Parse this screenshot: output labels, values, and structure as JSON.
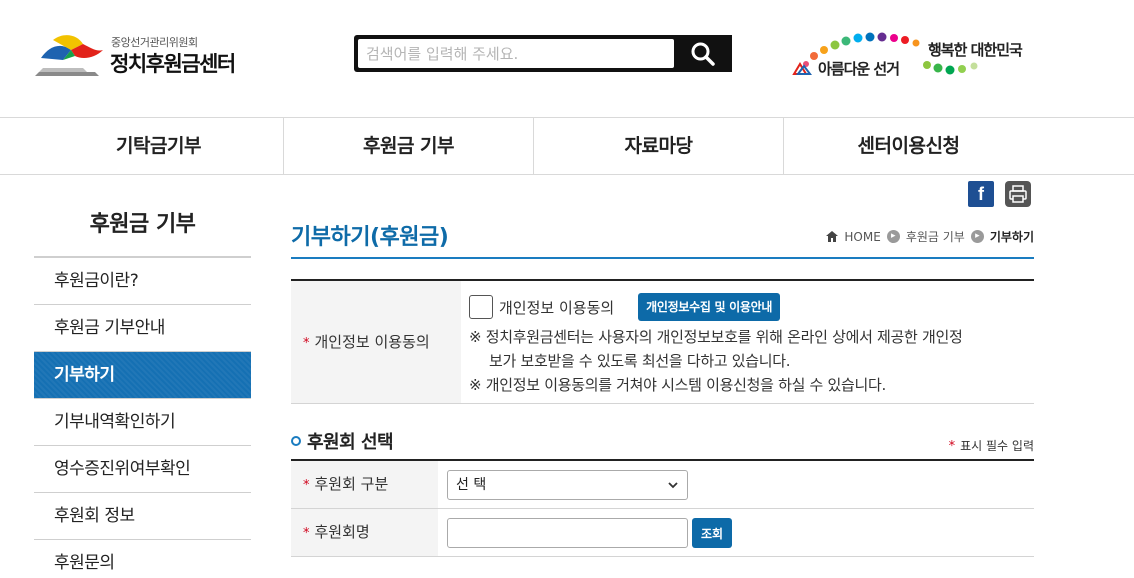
{
  "header": {
    "logo_sub": "중앙선거관리위원회",
    "logo_main": "정치후원금센터",
    "search": {
      "placeholder": "검색어를 입력해 주세요."
    },
    "slogan_right": "행복한 대한민국",
    "slogan_left": "아름다운 선거"
  },
  "nav": {
    "items": [
      {
        "label": "기탁금기부"
      },
      {
        "label": "후원금 기부"
      },
      {
        "label": "자료마당"
      },
      {
        "label": "센터이용신청"
      }
    ]
  },
  "social": {
    "facebook_glyph": "f"
  },
  "sidebar": {
    "title": "후원금 기부",
    "items": [
      {
        "label": "후원금이란?",
        "active": false
      },
      {
        "label": "후원금 기부안내",
        "active": false
      },
      {
        "label": "기부하기",
        "active": true
      },
      {
        "label": "기부내역확인하기",
        "active": false
      },
      {
        "label": "영수증진위여부확인",
        "active": false
      },
      {
        "label": "후원회 정보",
        "active": false
      },
      {
        "label": "후원문의",
        "active": false
      }
    ]
  },
  "content": {
    "page_title": "기부하기(후원금)",
    "breadcrumb": {
      "home": "HOME",
      "level1": "후원금 기부",
      "current": "기부하기"
    },
    "consent": {
      "label": "개인정보 이용동의",
      "checkbox_label": "개인정보 이용동의",
      "button_label": "개인정보수집 및 이용안내",
      "notice_1a": "※ 정치후원금센터는 사용자의 개인정보보호를 위해 온라인 상에서 제공한 개인정",
      "notice_1b": "보가 보호받을 수 있도록 최선을 다하고 있습니다.",
      "notice_2": "※ 개인정보 이용동의를 거쳐야 시스템 이용신청을 하실 수 있습니다."
    },
    "section": {
      "title": "후원회 선택",
      "required_note": "표시 필수 입력"
    },
    "form": {
      "type_label": "후원회 구분",
      "type_value": "선 택",
      "name_label": "후원회명",
      "name_value": "",
      "search_button": "조회"
    },
    "required_mark": "*"
  },
  "colors": {
    "accent": "#0e6ba8",
    "active_bg": "#1570b3",
    "required": "#d0021b",
    "facebook": "#1e4f93"
  }
}
